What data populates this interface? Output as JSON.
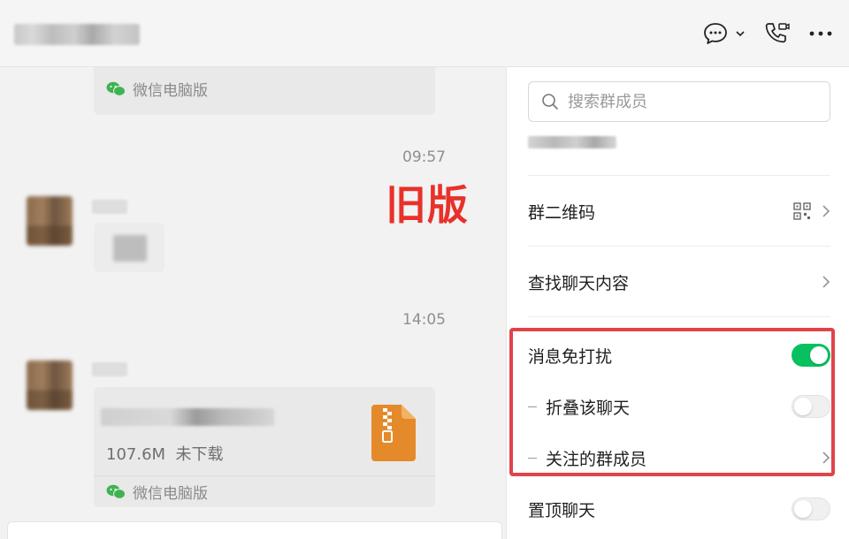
{
  "header": {
    "actions": [
      {
        "icon": "chat-bubble-icon",
        "has_dropdown": true
      },
      {
        "icon": "phone-video-icon"
      },
      {
        "icon": "more-dots-icon"
      }
    ]
  },
  "chat": {
    "messages": [
      {
        "type": "card",
        "source": "微信电脑版"
      },
      {
        "type": "time",
        "text": "09:57"
      },
      {
        "type": "image"
      },
      {
        "type": "time",
        "text": "14:05"
      },
      {
        "type": "file",
        "size": "107.6M",
        "status": "未下载",
        "source": "微信电脑版",
        "icon": "zip-file-icon"
      }
    ],
    "overlay_label": "旧版"
  },
  "panel": {
    "search": {
      "placeholder": "搜索群成员"
    },
    "rows": [
      {
        "label": "群二维码",
        "right": "qr-code-icon"
      },
      {
        "label": "查找聊天内容"
      },
      {
        "label": "消息免打扰",
        "toggle": true
      },
      {
        "label": "折叠该聊天",
        "toggle": false,
        "sub": true
      },
      {
        "label": "关注的群成员",
        "sub": true
      },
      {
        "label": "置顶聊天",
        "toggle": false
      }
    ]
  },
  "colors": {
    "toggle_on": "#07c160",
    "highlight": "#e0434a",
    "overlay_text": "#e8312a",
    "zip_icon": "#e48a2a"
  }
}
